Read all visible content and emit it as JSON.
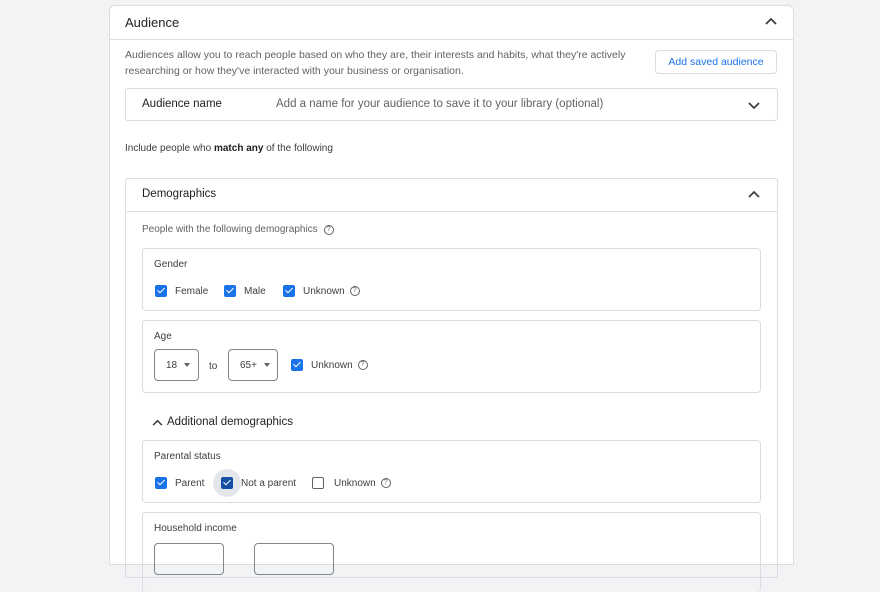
{
  "audience": {
    "title": "Audience",
    "description": "Audiences allow you to reach people based on who they are, their interests and habits, what they're actively researching or how they've interacted with your business or organisation.",
    "add_saved_button": "Add saved audience",
    "name_row": {
      "label": "Audience name",
      "placeholder": "Add a name for your audience to save it to your library (optional)"
    },
    "include_prefix": "Include people who",
    "include_bold": "match any",
    "include_suffix": "of the following"
  },
  "demographics": {
    "title": "Demographics",
    "subtitle": "People with the following demographics",
    "gender": {
      "title": "Gender",
      "options": [
        {
          "label": "Female",
          "checked": true
        },
        {
          "label": "Male",
          "checked": true
        },
        {
          "label": "Unknown",
          "checked": true
        }
      ]
    },
    "age": {
      "title": "Age",
      "from": "18",
      "to_label": "to",
      "to": "65+",
      "unknown_label": "Unknown",
      "unknown_checked": true
    },
    "additional_label": "Additional demographics",
    "parental": {
      "title": "Parental status",
      "options": [
        {
          "label": "Parent",
          "checked": true
        },
        {
          "label": "Not a parent",
          "checked": true
        },
        {
          "label": "Unknown",
          "checked": false
        }
      ]
    },
    "household": {
      "title": "Household income"
    }
  },
  "colors": {
    "accent": "#1a73e8",
    "border": "#dadce0",
    "background": "#f1f3f4"
  }
}
